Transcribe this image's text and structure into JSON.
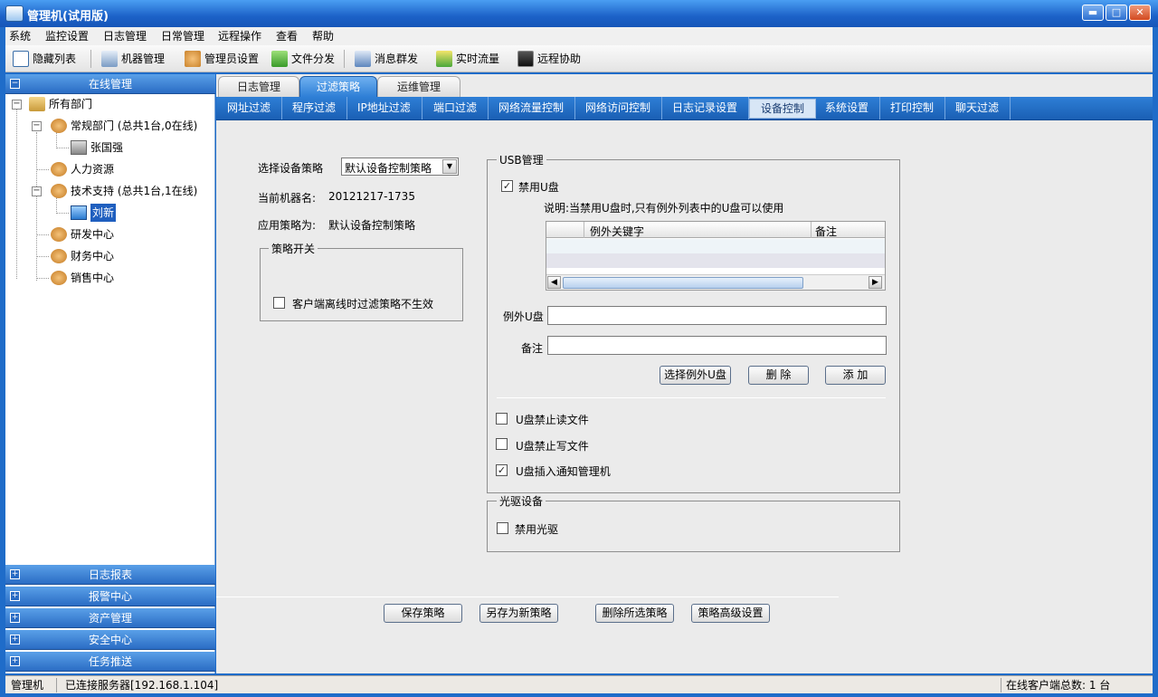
{
  "window": {
    "title": "管理机(试用版)",
    "minimize": "▬",
    "maximize": "□",
    "close": "✕"
  },
  "menu": [
    "系统",
    "监控设置",
    "日志管理",
    "日常管理",
    "远程操作",
    "查看",
    "帮助"
  ],
  "toolbar": {
    "hide_list": "隐藏列表",
    "machine_mgmt": "机器管理",
    "admin_settings": "管理员设置",
    "file_dist": "文件分发",
    "msg_broadcast": "消息群发",
    "realtime_traffic": "实时流量",
    "remote_assist": "远程协助"
  },
  "left": {
    "online_mgmt": "在线管理",
    "tree": {
      "root": "所有部门",
      "dept1": "常规部门 (总共1台,0在线)",
      "dept1_user": "张国强",
      "dept2": "人力资源",
      "dept3": "技术支持 (总共1台,1在线)",
      "dept3_user": "刘新",
      "dept4": "研发中心",
      "dept5": "财务中心",
      "dept6": "销售中心"
    },
    "sections": [
      "日志报表",
      "报警中心",
      "资产管理",
      "安全中心",
      "任务推送"
    ]
  },
  "tabs": [
    "日志管理",
    "过滤策略",
    "运维管理"
  ],
  "subtabs": [
    "网址过滤",
    "程序过滤",
    "IP地址过滤",
    "端口过滤",
    "网络流量控制",
    "网络访问控制",
    "日志记录设置",
    "设备控制",
    "系统设置",
    "打印控制",
    "聊天过滤"
  ],
  "policy": {
    "select_label": "选择设备策略",
    "select_value": "默认设备控制策略",
    "machine_label": "当前机器名:",
    "machine_value": "20121217-1735",
    "apply_label": "应用策略为:",
    "apply_value": "默认设备控制策略",
    "switch_title": "策略开关",
    "offline_checkbox": "客户端离线时过滤策略不生效"
  },
  "usb": {
    "title": "USB管理",
    "disable_udisk": "禁用U盘",
    "note": "说明:当禁用U盘时,只有例外列表中的U盘可以使用",
    "col_keyword": "例外关键字",
    "col_remark": "备注",
    "exception_label": "例外U盘",
    "remark_label": "备注",
    "btn_select": "选择例外U盘",
    "btn_delete": "删 除",
    "btn_add": "添 加",
    "opt_no_read": "U盘禁止读文件",
    "opt_no_write": "U盘禁止写文件",
    "opt_notify": "U盘插入通知管理机"
  },
  "optical": {
    "title": "光驱设备",
    "disable": "禁用光驱"
  },
  "actions": {
    "save": "保存策略",
    "save_as": "另存为新策略",
    "delete": "删除所选策略",
    "advanced": "策略高级设置"
  },
  "status": {
    "left1": "管理机",
    "left2": "已连接服务器[192.168.1.104]",
    "right": "在线客户端总数:  1 台"
  }
}
